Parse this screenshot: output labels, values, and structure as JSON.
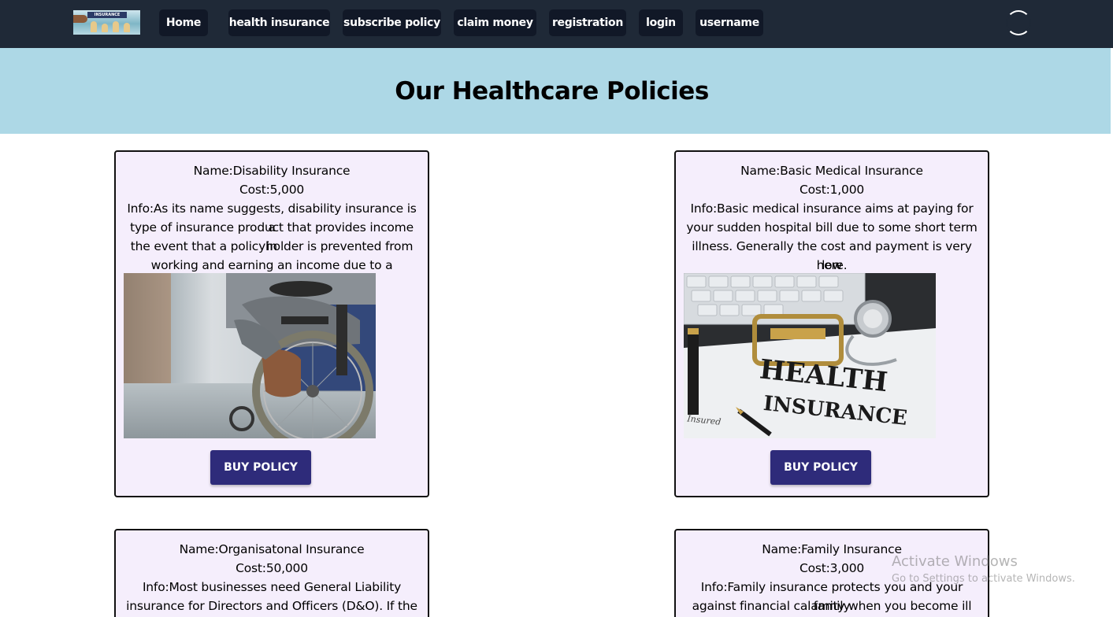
{
  "nav": {
    "items": [
      {
        "label": "Home"
      },
      {
        "label": "health insurance"
      },
      {
        "label": "subscribe policy"
      },
      {
        "label": "claim money"
      },
      {
        "label": "registration"
      },
      {
        "label": "login"
      },
      {
        "label": "username"
      }
    ],
    "logo_text": "INSURANCE"
  },
  "hero": {
    "title": "Our Healthcare Policies"
  },
  "policies": [
    {
      "name": "Name:Disability Insurance",
      "cost": "Cost:5,000",
      "info_lines": [
        "Info:As its name suggests, disability insurance is a",
        "type of insurance product that provides income in",
        "the event that a policyholder is prevented from",
        "working and earning an income due to a disability."
      ],
      "image": "wheelchair-photo",
      "button": "BUY POLICY"
    },
    {
      "name": "Name:Basic Medical Insurance",
      "cost": "Cost:1,000",
      "info_lines": [
        "Info:Basic medical insurance aims at paying for",
        "your sudden hospital bill due to some short term",
        "illness. Generally the cost and payment is very low",
        "here."
      ],
      "image": "health-insurance-clipboard-photo",
      "image_text": "HEALTH INSURANCE",
      "image_small_text": "Insured",
      "button": "BUY POLICY"
    },
    {
      "name": "Name:Organisatonal Insurance",
      "cost": "Cost:50,000",
      "info_lines": [
        "Info:Most businesses need General Liability",
        "insurance for Directors and Officers (D&O). If the"
      ]
    },
    {
      "name": "Name:Family Insurance",
      "cost": "Cost:3,000",
      "info_lines": [
        "Info:Family insurance protects you and your family",
        "against financial calamity when you become ill or"
      ]
    }
  ],
  "watermark": {
    "title": "Activate Windows",
    "subtitle": "Go to Settings to activate Windows."
  }
}
